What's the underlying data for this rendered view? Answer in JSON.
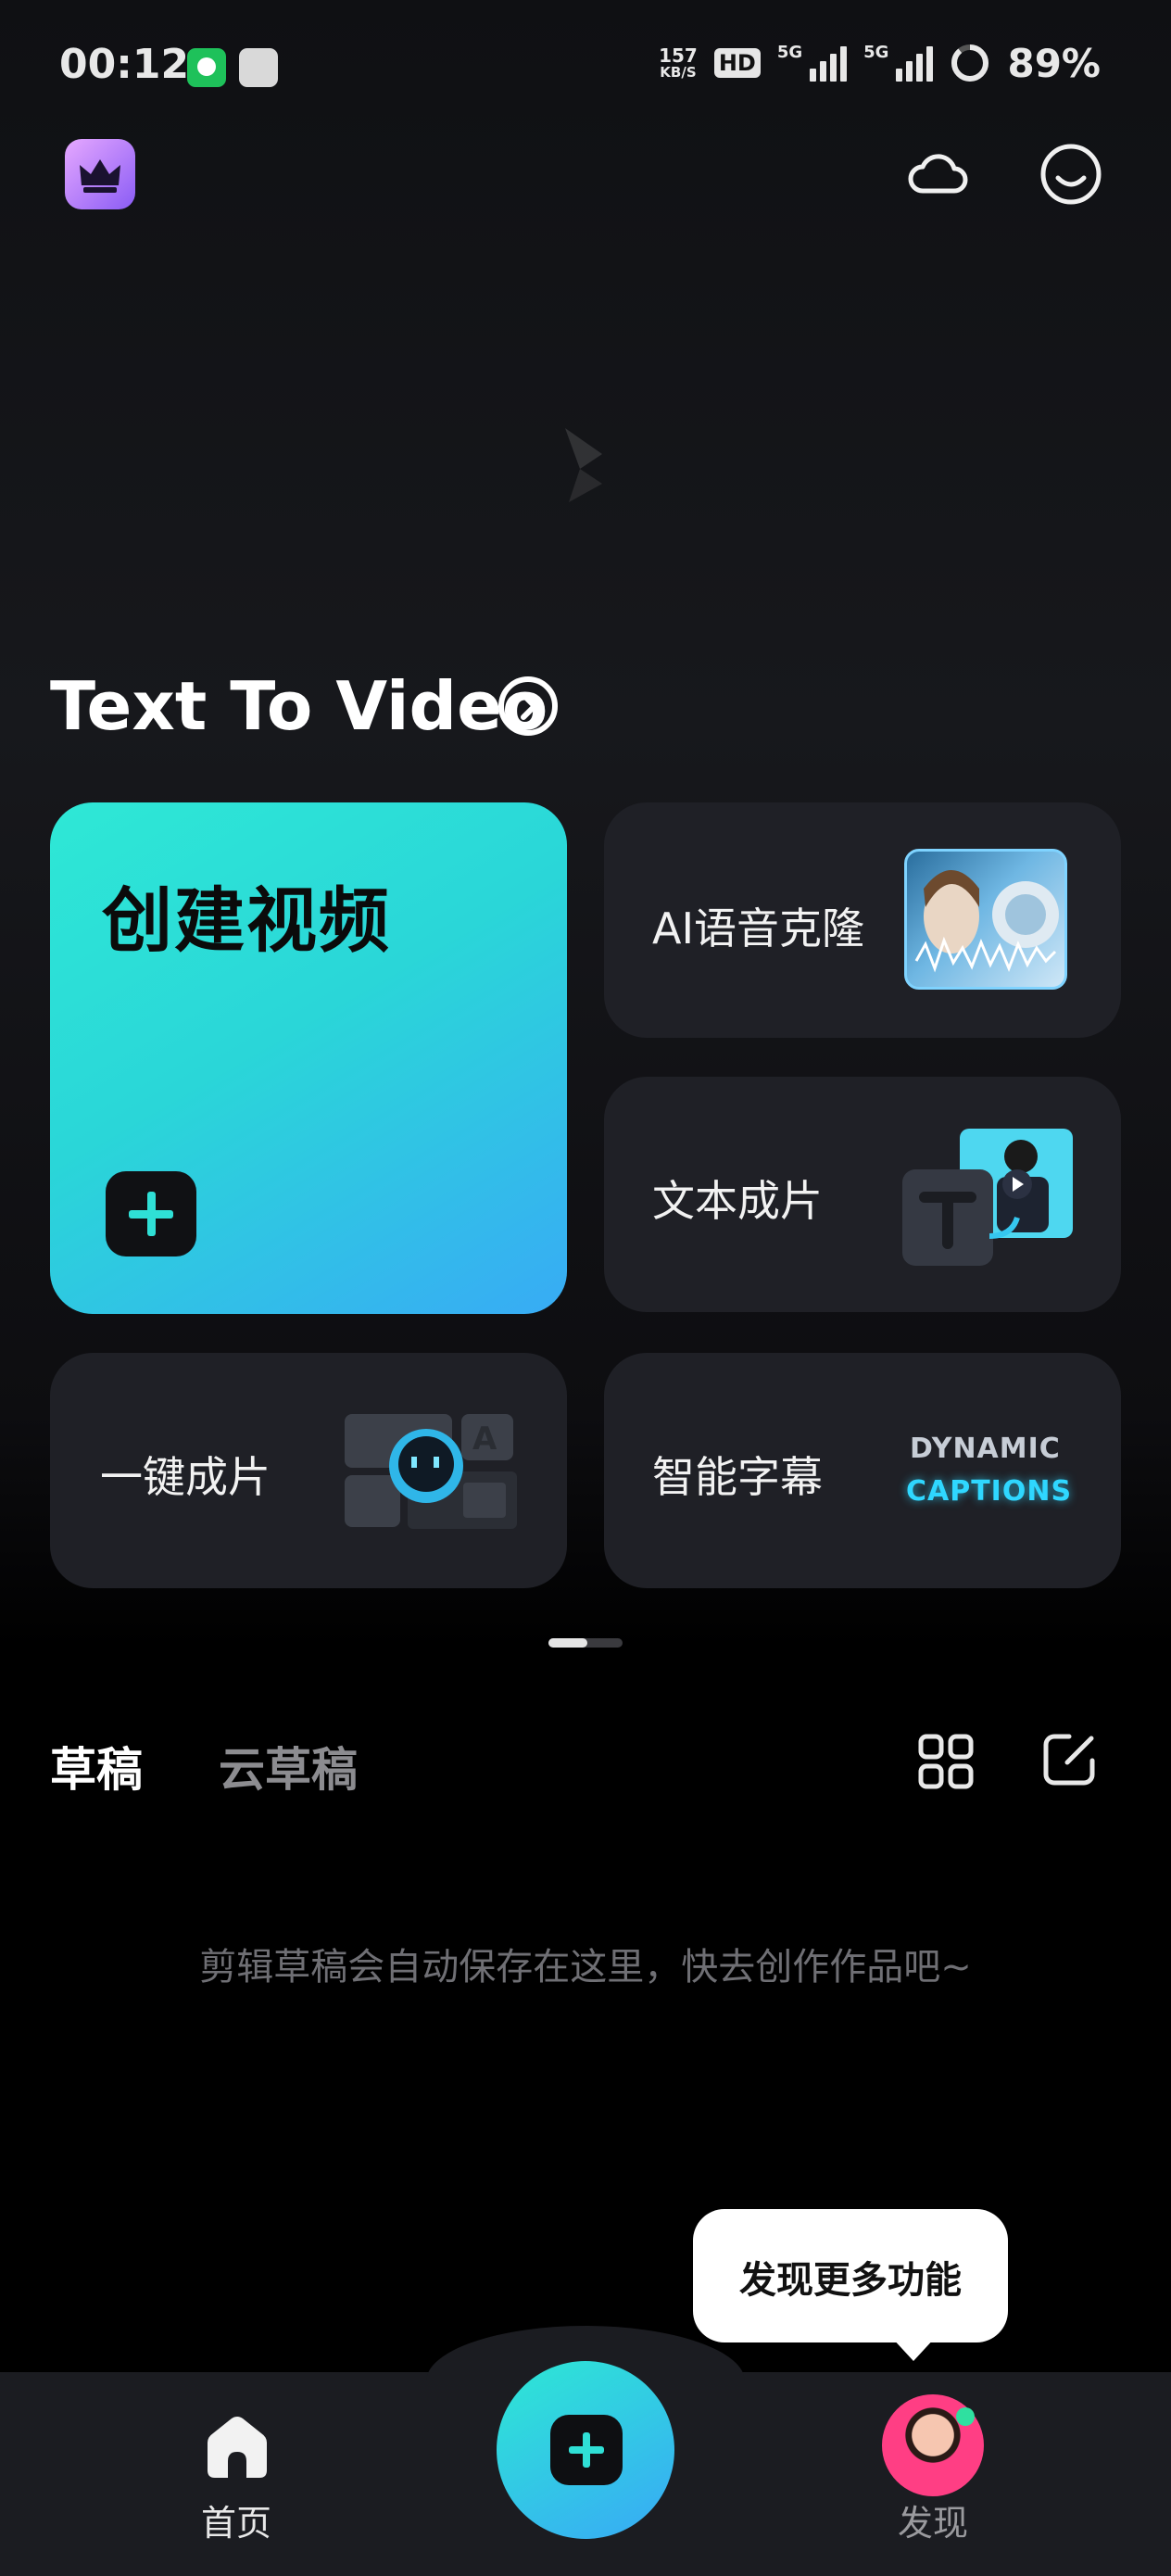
{
  "status_bar": {
    "time": "00:12",
    "speed_value": "157",
    "speed_unit": "KB/S",
    "hd": "HD",
    "network_1": "5G",
    "network_2": "5G",
    "battery": "89%",
    "battery_level": 0.89
  },
  "header": {
    "vip_icon": "crown-icon",
    "cloud_icon": "cloud-icon",
    "profile_icon": "smile-icon"
  },
  "section": {
    "title": "Text To Video"
  },
  "cards": {
    "create": "创建视频",
    "ai_voice": "AI语音克隆",
    "text_to_film": "文本成片",
    "one_click": "一键成片",
    "captions": "智能字幕",
    "captions_badge_1": "DYNAMIC",
    "captions_badge_2": "CAPTIONS"
  },
  "drafts": {
    "tab_local": "草稿",
    "tab_cloud": "云草稿",
    "empty_hint": "剪辑草稿会自动保存在这里，快去创作作品吧~"
  },
  "tooltip": {
    "text": "发现更多功能"
  },
  "bottom_nav": {
    "home": "首页",
    "discover": "发现"
  },
  "colors": {
    "accent_start": "#2ee8d6",
    "accent_end": "#38abf5",
    "card_bg": "#1f2026",
    "background": "#000000"
  }
}
